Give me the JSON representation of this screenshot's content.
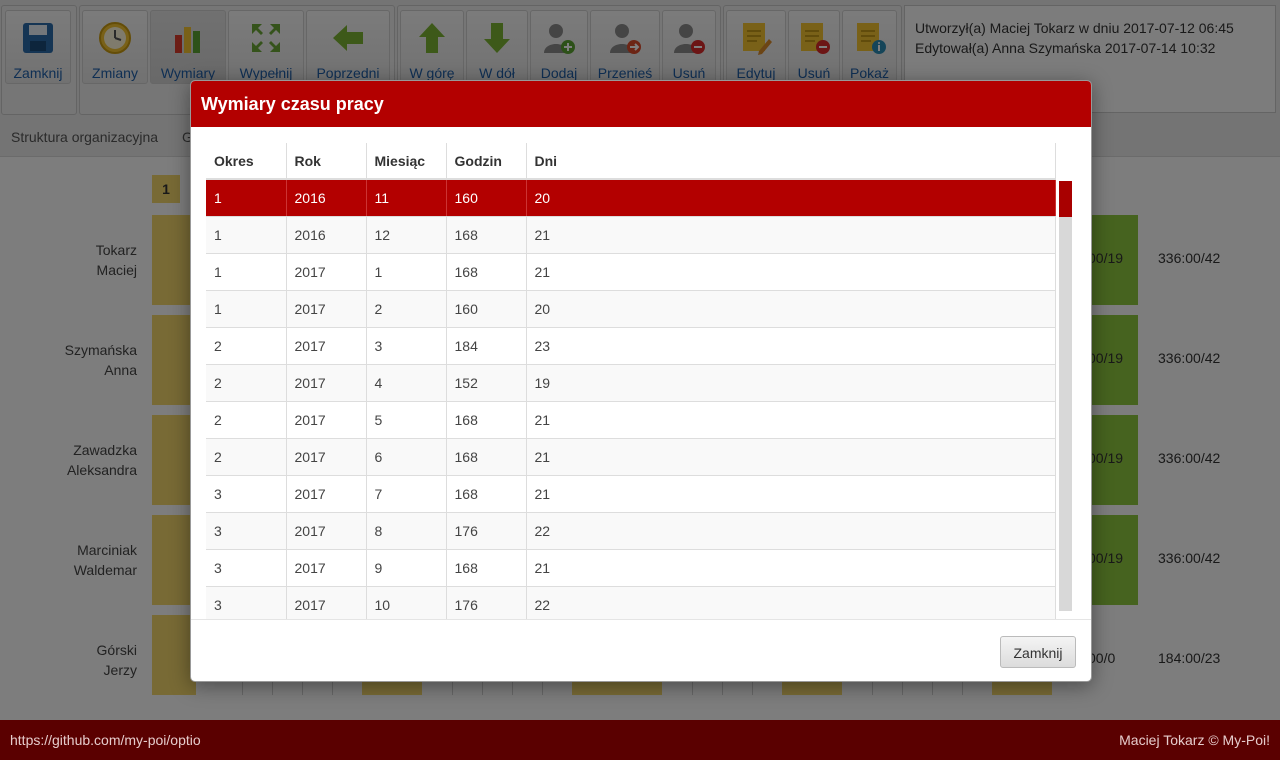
{
  "toolbar": {
    "buttons": [
      {
        "label": "Zamknij"
      },
      {
        "label": "Zmiany"
      },
      {
        "label": "Wymiary"
      },
      {
        "label": "Wypełnij"
      },
      {
        "label": "Poprzedni"
      },
      {
        "label": "W górę"
      },
      {
        "label": "W dół"
      },
      {
        "label": "Dodaj"
      },
      {
        "label": "Przenieś"
      },
      {
        "label": "Usuń"
      },
      {
        "label": "Edytuj"
      },
      {
        "label": "Usuń"
      },
      {
        "label": "Pokaż"
      }
    ],
    "info": {
      "created": "Utworzył(a) Maciej Tokarz w dniu 2017-07-12 06:45",
      "edited": "Edytował(a) Anna Szymańska 2017-07-14 10:32"
    }
  },
  "subnav": {
    "item1": "Struktura organizacyjna",
    "item2": "G"
  },
  "background": {
    "day_number": "1",
    "people": [
      {
        "first": "Tokarz",
        "second": "Maciej",
        "green": "00/19",
        "total": "336:00/42"
      },
      {
        "first": "Szymańska",
        "second": "Anna",
        "green": "00/19",
        "total": "336:00/42"
      },
      {
        "first": "Zawadzka",
        "second": "Aleksandra",
        "green": "00/19",
        "total": "336:00/42"
      },
      {
        "first": "Marciniak",
        "second": "Waldemar",
        "green": "00/19",
        "total": "336:00/42"
      },
      {
        "first": "Górski",
        "second": "Jerzy",
        "green": "00/0",
        "total": "184:00/23"
      }
    ]
  },
  "modal": {
    "title": "Wymiary czasu pracy",
    "columns": [
      "Okres",
      "Rok",
      "Miesiąc",
      "Godzin",
      "Dni"
    ],
    "rows": [
      [
        "1",
        "2016",
        "11",
        "160",
        "20"
      ],
      [
        "1",
        "2016",
        "12",
        "168",
        "21"
      ],
      [
        "1",
        "2017",
        "1",
        "168",
        "21"
      ],
      [
        "1",
        "2017",
        "2",
        "160",
        "20"
      ],
      [
        "2",
        "2017",
        "3",
        "184",
        "23"
      ],
      [
        "2",
        "2017",
        "4",
        "152",
        "19"
      ],
      [
        "2",
        "2017",
        "5",
        "168",
        "21"
      ],
      [
        "2",
        "2017",
        "6",
        "168",
        "21"
      ],
      [
        "3",
        "2017",
        "7",
        "168",
        "21"
      ],
      [
        "3",
        "2017",
        "8",
        "176",
        "22"
      ],
      [
        "3",
        "2017",
        "9",
        "168",
        "21"
      ],
      [
        "3",
        "2017",
        "10",
        "176",
        "22"
      ]
    ],
    "selected_row": 0,
    "close_label": "Zamknij"
  },
  "footer": {
    "left": "https://github.com/my-poi/optio",
    "right": "Maciej Tokarz © My-Poi!"
  },
  "colors": {
    "accent": "#b30000",
    "footer": "#5a0000",
    "yellow": "#f0d46a",
    "green": "#8dc63f"
  }
}
